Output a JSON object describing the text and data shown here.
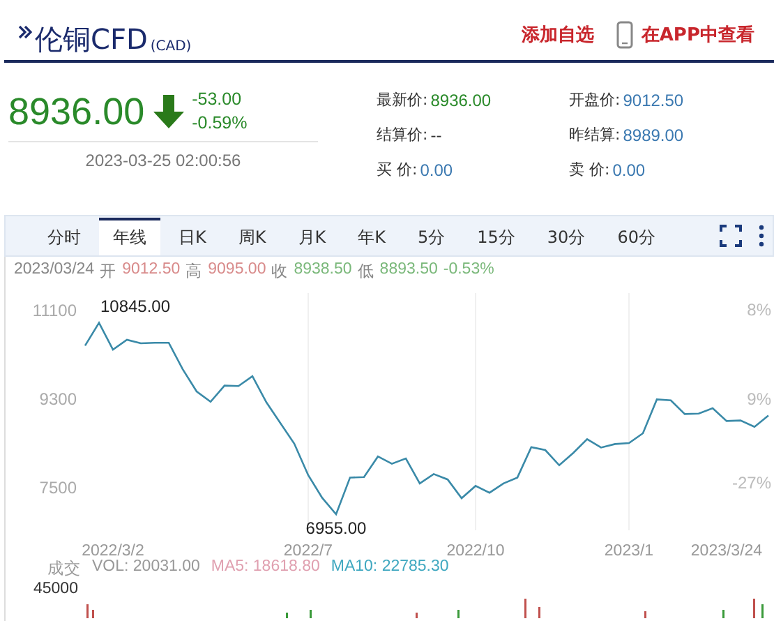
{
  "header": {
    "title": "伦铜CFD",
    "code": "(CAD)",
    "actions": [
      {
        "label": "添加自选",
        "kind": "text"
      },
      {
        "label": "在APP中查看",
        "kind": "phone"
      }
    ]
  },
  "quote": {
    "price": "8936.00",
    "down": true,
    "change": "-53.00",
    "change_pct": "-0.59%",
    "time": "2023-03-25 02:00:56"
  },
  "field_rows": [
    {
      "cells": [
        {
          "label": "最新价:",
          "value": "8936.00",
          "kind": "down"
        },
        {
          "label": "开盘价:",
          "value": "9012.50",
          "kind": "neutral"
        }
      ]
    },
    {
      "cells": [
        {
          "label": "结算价:",
          "value": "--",
          "kind": "plain"
        },
        {
          "label": "昨结算:",
          "value": "8989.00",
          "kind": "neutral"
        }
      ]
    },
    {
      "cells": [
        {
          "label": "买 价:",
          "value": "0.00",
          "kind": "neutral"
        },
        {
          "label": "卖 价:",
          "value": "0.00",
          "kind": "neutral"
        }
      ]
    }
  ],
  "tabs": [
    {
      "label": "分时",
      "selected": false
    },
    {
      "label": "年线",
      "selected": true
    },
    {
      "label": "日K",
      "selected": false
    },
    {
      "label": "周K",
      "selected": false
    },
    {
      "label": "月K",
      "selected": false
    },
    {
      "label": "年K",
      "selected": false
    },
    {
      "label": "5分",
      "selected": false
    },
    {
      "label": "15分",
      "selected": false
    },
    {
      "label": "30分",
      "selected": false
    },
    {
      "label": "60分",
      "selected": false
    }
  ],
  "summary": [
    {
      "text": "2023/03/24",
      "kind": "plain"
    },
    {
      "text": "开",
      "kind": "plain"
    },
    {
      "text": "9012.50",
      "kind": "up"
    },
    {
      "text": "高",
      "kind": "plain"
    },
    {
      "text": "9095.00",
      "kind": "up"
    },
    {
      "text": "收",
      "kind": "plain"
    },
    {
      "text": "8938.50",
      "kind": "down"
    },
    {
      "text": "低",
      "kind": "plain"
    },
    {
      "text": "8893.50",
      "kind": "down"
    },
    {
      "text": "-0.53%",
      "kind": "down"
    }
  ],
  "chart": {
    "chart_data": {
      "type": "line",
      "grid": true,
      "ylim": [
        6600,
        11450
      ],
      "yticks": [
        11100,
        9300,
        7500
      ],
      "categories": [
        null,
        null,
        "2022/3/2",
        null,
        null,
        null,
        null,
        null,
        null,
        null,
        null,
        null,
        null,
        null,
        null,
        null,
        "2022/7",
        null,
        null,
        null,
        null,
        null,
        null,
        null,
        null,
        null,
        null,
        null,
        "2022/10",
        null,
        null,
        null,
        null,
        null,
        null,
        null,
        null,
        null,
        null,
        "2023/1",
        null,
        null,
        null,
        null,
        null,
        null,
        "2023/3/24",
        null,
        null,
        null
      ],
      "series": [
        {
          "color": "#3a8aa8",
          "values": [
            10380,
            10845,
            10300,
            10500,
            10430,
            10440,
            10440,
            9900,
            9450,
            9240,
            9570,
            9560,
            9760,
            9230,
            8810,
            8390,
            7750,
            7290,
            6955,
            7700,
            7710,
            8130,
            7980,
            8090,
            7580,
            7770,
            7660,
            7280,
            7530,
            7390,
            7580,
            7700,
            8320,
            8260,
            7950,
            8200,
            8480,
            8310,
            8380,
            8400,
            8600,
            9290,
            9270,
            8990,
            9000,
            9110,
            8850,
            8860,
            8730,
            8960
          ]
        }
      ],
      "annotations": [
        "10845.00",
        "6955.00"
      ]
    },
    "right_labels": [
      "8%",
      "9%",
      "-27%"
    ]
  },
  "volume": {
    "title": "成交",
    "vol": "VOL: 20031.00",
    "ma5": "MA5: 18618.80",
    "ma10": "MA10: 22785.30",
    "max": "45000"
  }
}
